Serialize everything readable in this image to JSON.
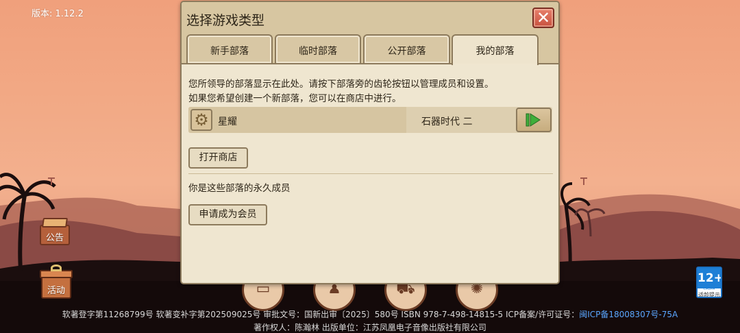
{
  "app": {
    "version_label": "版本: 1.12.2"
  },
  "side_buttons": {
    "notice_label": "公告",
    "event_label": "活动"
  },
  "dialog": {
    "title": "选择游戏类型",
    "close_icon": "close-icon",
    "tabs": [
      {
        "label": "新手部落",
        "active": false
      },
      {
        "label": "临时部落",
        "active": false
      },
      {
        "label": "公开部落",
        "active": false
      },
      {
        "label": "我的部落",
        "active": true
      }
    ],
    "intro_line_1": "您所领导的部落显示在此处。请按下部落旁的齿轮按钮以管理成员和设置。",
    "intro_line_2": "如果您希望创建一个新部落，您可以在商店中进行。",
    "tribes": [
      {
        "name": "星耀",
        "era": "石器时代 二",
        "settings_icon": "gear-icon",
        "play_icon": "play-icon"
      }
    ],
    "open_shop_label": "打开商店",
    "permanent_member_label": "你是这些部落的永久成员",
    "apply_member_label": "申请成为会员"
  },
  "age_rating": {
    "rating": "12+",
    "org": "CADPA",
    "caption": "适龄提示"
  },
  "footer": {
    "line1_text": "软著登字第11268799号 软著变补字第202509025号 审批文号：国新出审〔2025〕580号 ISBN 978-7-498-14815-5 ICP备案/许可证号：",
    "line1_link": "闽ICP备18008307号-75A",
    "line2_text": "著作权人：陈瀚林 出版单位：江苏凤凰电子音像出版社有限公司"
  },
  "colors": {
    "panel_bg": "#efe6d0",
    "panel_border": "#8c7a5c",
    "close_red": "#c8523f",
    "play_green": "#3fae3a",
    "link_blue": "#5aa6ff",
    "rating_blue": "#1e7fd6"
  }
}
